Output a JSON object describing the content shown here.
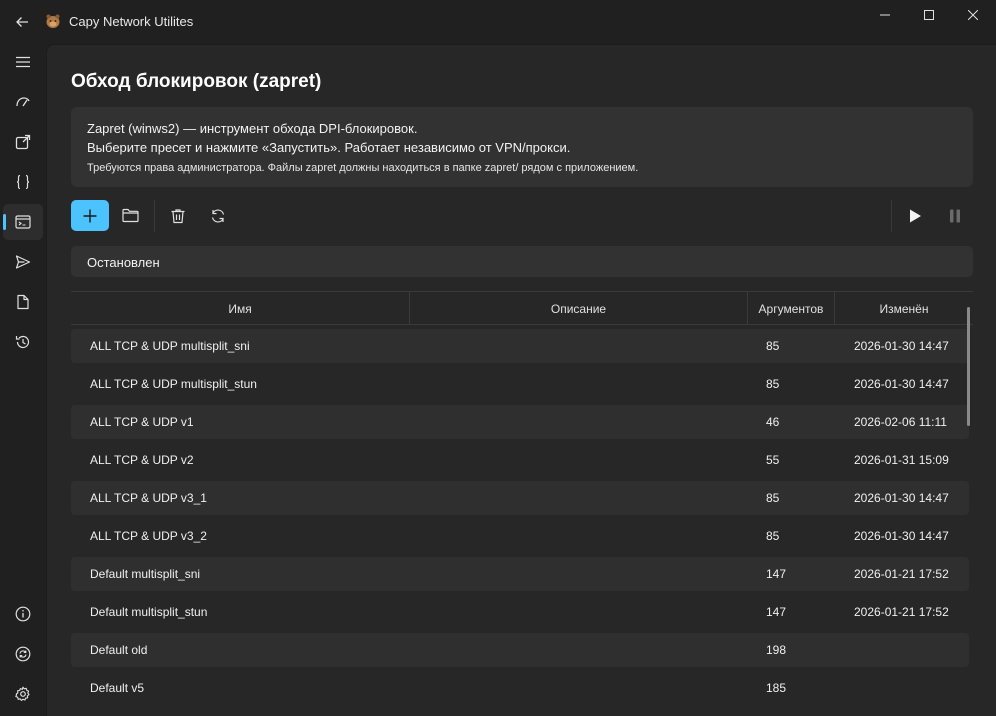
{
  "app": {
    "title": "Capy Network Utilites"
  },
  "page": {
    "title": "Обход блокировок (zapret)",
    "info": {
      "line1": "Zapret (winws2) — инструмент обхода DPI-блокировок.",
      "line2": "Выберите пресет и нажмите «Запустить». Работает независимо от VPN/прокси.",
      "line3": "Требуются права администратора. Файлы zapret должны находиться в папке zapret/ рядом с приложением."
    },
    "status": "Остановлен"
  },
  "toolbar": {
    "icons": [
      "add-icon",
      "folder-icon",
      "delete-icon",
      "refresh-icon",
      "play-icon",
      "pause-icon"
    ]
  },
  "sidebar": {
    "items": [
      "menu-icon",
      "speed-icon",
      "open-external-icon",
      "braces-icon",
      "terminal-icon",
      "send-icon",
      "document-icon",
      "history-icon"
    ],
    "bottom": [
      "info-icon",
      "sync-icon",
      "settings-icon"
    ],
    "active": "terminal-icon"
  },
  "table": {
    "columns": {
      "name": "Имя",
      "description": "Описание",
      "args": "Аргументов",
      "modified": "Изменён"
    },
    "rows": [
      {
        "name": "ALL TCP & UDP multisplit_sni",
        "description": "",
        "args": "85",
        "modified": "2026-01-30 14:47"
      },
      {
        "name": "ALL TCP & UDP multisplit_stun",
        "description": "",
        "args": "85",
        "modified": "2026-01-30 14:47"
      },
      {
        "name": "ALL TCP & UDP v1",
        "description": "",
        "args": "46",
        "modified": "2026-02-06 11:11"
      },
      {
        "name": "ALL TCP & UDP v2",
        "description": "",
        "args": "55",
        "modified": "2026-01-31 15:09"
      },
      {
        "name": "ALL TCP & UDP v3_1",
        "description": "",
        "args": "85",
        "modified": "2026-01-30 14:47"
      },
      {
        "name": "ALL TCP & UDP v3_2",
        "description": "",
        "args": "85",
        "modified": "2026-01-30 14:47"
      },
      {
        "name": "Default multisplit_sni",
        "description": "",
        "args": "147",
        "modified": "2026-01-21 17:52"
      },
      {
        "name": "Default multisplit_stun",
        "description": "",
        "args": "147",
        "modified": "2026-01-21 17:52"
      },
      {
        "name": "Default old",
        "description": "",
        "args": "198",
        "modified": ""
      },
      {
        "name": "Default v5",
        "description": "",
        "args": "185",
        "modified": ""
      }
    ]
  },
  "colors": {
    "accent": "#4cc2ff",
    "background": "#202020",
    "content": "#272727",
    "card": "#323232"
  }
}
